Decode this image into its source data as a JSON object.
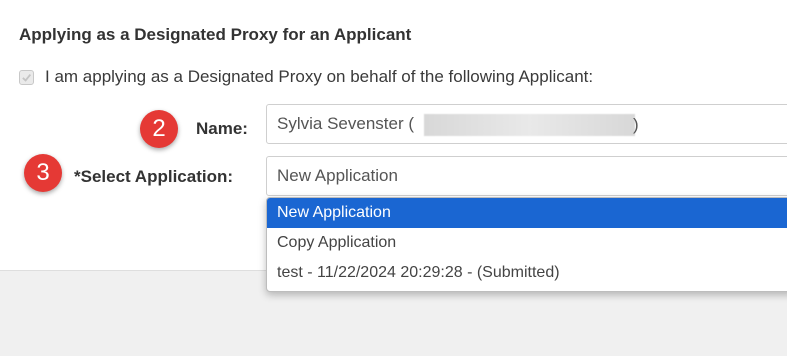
{
  "section": {
    "title": "Applying as a Designated Proxy for an Applicant"
  },
  "proxy_checkbox": {
    "label": "I am applying as a Designated Proxy on behalf of the following Applicant:",
    "checked": true
  },
  "steps": {
    "name_step": "2",
    "select_step": "3"
  },
  "fields": {
    "name_label": "Name:",
    "name_value": "Sylvia Sevenster (",
    "name_value_tail": ")",
    "select_label": "*Select Application:",
    "select_value": "New Application"
  },
  "dropdown": {
    "options": [
      {
        "label": "New Application",
        "selected": true
      },
      {
        "label": "Copy Application",
        "selected": false
      },
      {
        "label": "test - 11/22/2024 20:29:28 - (Submitted)",
        "selected": false
      }
    ]
  },
  "colors": {
    "badge": "#e53935",
    "selected_option": "#1a66d2"
  }
}
